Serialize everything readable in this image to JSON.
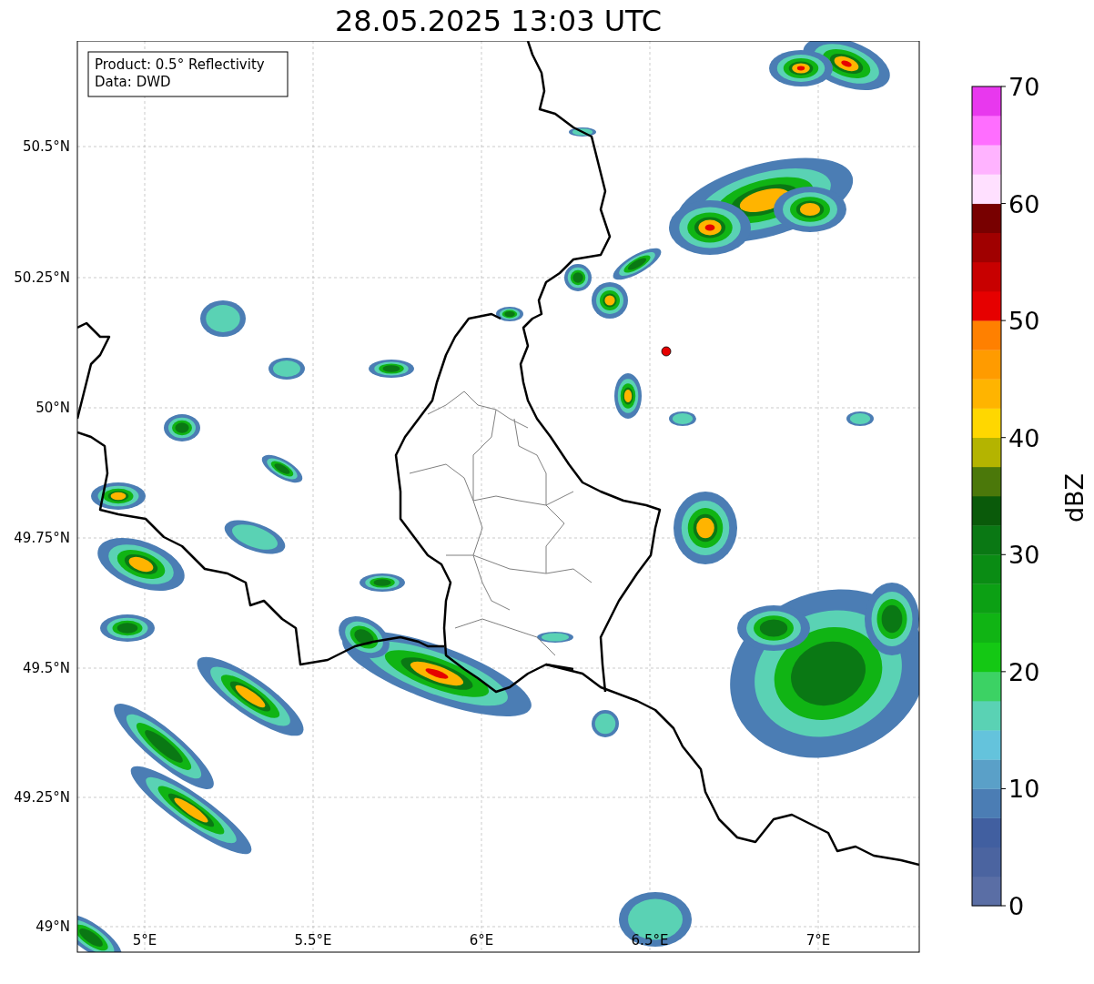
{
  "title": "28.05.2025 13:03 UTC",
  "map": {
    "legend": [
      "Product: 0.5° Reflectivity",
      "Data: DWD"
    ],
    "lat_ticks": [
      "50.5°N",
      "50.25°N",
      "50°N",
      "49.75°N",
      "49.5°N",
      "49.25°N",
      "49°N"
    ],
    "lon_ticks": [
      "5°E",
      "5.5°E",
      "6°E",
      "6.5°E",
      "7°E"
    ]
  },
  "colorbar": {
    "label": "dBZ",
    "ticks": [
      "70",
      "60",
      "50",
      "40",
      "30",
      "20",
      "10",
      "0"
    ],
    "segments": [
      {
        "color": "#5a6ea5"
      },
      {
        "color": "#4b64a0"
      },
      {
        "color": "#415fa0"
      },
      {
        "color": "#4b7db4"
      },
      {
        "color": "#5aa0c8"
      },
      {
        "color": "#64c3dc"
      },
      {
        "color": "#5ad2b4"
      },
      {
        "color": "#3cd264"
      },
      {
        "color": "#14c814"
      },
      {
        "color": "#10b414"
      },
      {
        "color": "#0ca014"
      },
      {
        "color": "#0a8c14"
      },
      {
        "color": "#0a7814"
      },
      {
        "color": "#0a5a0a"
      },
      {
        "color": "#4b780a"
      },
      {
        "color": "#b4b400"
      },
      {
        "color": "#ffd700"
      },
      {
        "color": "#ffb400"
      },
      {
        "color": "#ff9b00"
      },
      {
        "color": "#ff8000"
      },
      {
        "color": "#e60000"
      },
      {
        "color": "#c80000"
      },
      {
        "color": "#a00000"
      },
      {
        "color": "#780000"
      },
      {
        "color": "#ffe0ff"
      },
      {
        "color": "#ffb3ff"
      },
      {
        "color": "#ff6eff"
      },
      {
        "color": "#e838ee"
      }
    ]
  }
}
